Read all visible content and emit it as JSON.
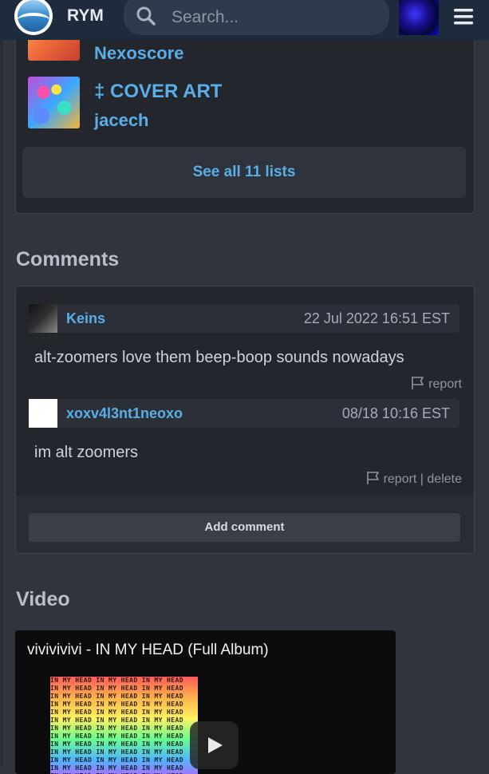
{
  "topbar": {
    "brand": "RYM",
    "search_placeholder": "Search...",
    "logo_icon": "rym-logo-icon",
    "menu_icon": "hamburger-menu-icon"
  },
  "lists": {
    "items": [
      {
        "title": "",
        "author": "Nexoscore"
      },
      {
        "title": "‡ COVER ART",
        "author": "jacech"
      }
    ],
    "see_all_label": "See all 11 lists"
  },
  "comments": {
    "heading": "Comments",
    "items": [
      {
        "user": "Keins",
        "date": "22 Jul 2022 16:51 EST",
        "text": "alt-zoomers love them beep-boop sounds nowadays",
        "report_label": "report"
      },
      {
        "user": "xoxv4l3nt1neoxo",
        "date": "08/18 10:16 EST",
        "text": "im alt zoomers",
        "report_label": "report",
        "separator": " | ",
        "delete_label": "delete"
      }
    ],
    "add_comment_label": "Add comment"
  },
  "video": {
    "heading": "Video",
    "title": "vivivivivi - IN MY HEAD (Full Album)",
    "thumb_text": "IN MY HEAD IN MY HEAD IN MY HEAD"
  },
  "colors": {
    "accent": "#5aaee8",
    "background": "#30343d",
    "card": "#23262d",
    "topbar": "#1d2b3c"
  }
}
